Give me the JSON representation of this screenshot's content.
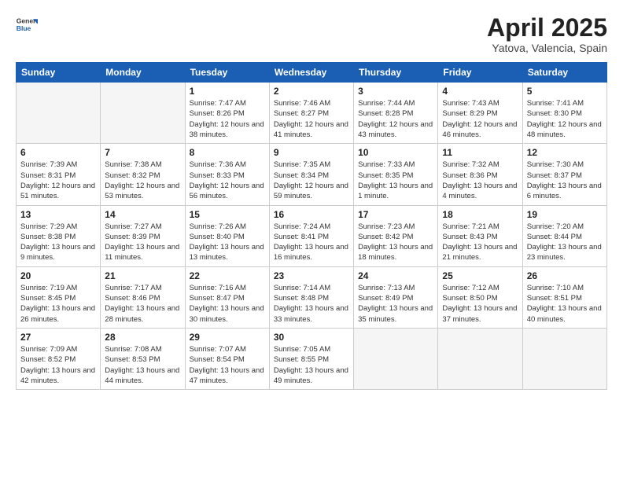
{
  "header": {
    "logo_general": "General",
    "logo_blue": "Blue",
    "title": "April 2025",
    "location": "Yatova, Valencia, Spain"
  },
  "weekdays": [
    "Sunday",
    "Monday",
    "Tuesday",
    "Wednesday",
    "Thursday",
    "Friday",
    "Saturday"
  ],
  "weeks": [
    [
      {
        "day": "",
        "info": ""
      },
      {
        "day": "",
        "info": ""
      },
      {
        "day": "1",
        "info": "Sunrise: 7:47 AM\nSunset: 8:26 PM\nDaylight: 12 hours and 38 minutes."
      },
      {
        "day": "2",
        "info": "Sunrise: 7:46 AM\nSunset: 8:27 PM\nDaylight: 12 hours and 41 minutes."
      },
      {
        "day": "3",
        "info": "Sunrise: 7:44 AM\nSunset: 8:28 PM\nDaylight: 12 hours and 43 minutes."
      },
      {
        "day": "4",
        "info": "Sunrise: 7:43 AM\nSunset: 8:29 PM\nDaylight: 12 hours and 46 minutes."
      },
      {
        "day": "5",
        "info": "Sunrise: 7:41 AM\nSunset: 8:30 PM\nDaylight: 12 hours and 48 minutes."
      }
    ],
    [
      {
        "day": "6",
        "info": "Sunrise: 7:39 AM\nSunset: 8:31 PM\nDaylight: 12 hours and 51 minutes."
      },
      {
        "day": "7",
        "info": "Sunrise: 7:38 AM\nSunset: 8:32 PM\nDaylight: 12 hours and 53 minutes."
      },
      {
        "day": "8",
        "info": "Sunrise: 7:36 AM\nSunset: 8:33 PM\nDaylight: 12 hours and 56 minutes."
      },
      {
        "day": "9",
        "info": "Sunrise: 7:35 AM\nSunset: 8:34 PM\nDaylight: 12 hours and 59 minutes."
      },
      {
        "day": "10",
        "info": "Sunrise: 7:33 AM\nSunset: 8:35 PM\nDaylight: 13 hours and 1 minute."
      },
      {
        "day": "11",
        "info": "Sunrise: 7:32 AM\nSunset: 8:36 PM\nDaylight: 13 hours and 4 minutes."
      },
      {
        "day": "12",
        "info": "Sunrise: 7:30 AM\nSunset: 8:37 PM\nDaylight: 13 hours and 6 minutes."
      }
    ],
    [
      {
        "day": "13",
        "info": "Sunrise: 7:29 AM\nSunset: 8:38 PM\nDaylight: 13 hours and 9 minutes."
      },
      {
        "day": "14",
        "info": "Sunrise: 7:27 AM\nSunset: 8:39 PM\nDaylight: 13 hours and 11 minutes."
      },
      {
        "day": "15",
        "info": "Sunrise: 7:26 AM\nSunset: 8:40 PM\nDaylight: 13 hours and 13 minutes."
      },
      {
        "day": "16",
        "info": "Sunrise: 7:24 AM\nSunset: 8:41 PM\nDaylight: 13 hours and 16 minutes."
      },
      {
        "day": "17",
        "info": "Sunrise: 7:23 AM\nSunset: 8:42 PM\nDaylight: 13 hours and 18 minutes."
      },
      {
        "day": "18",
        "info": "Sunrise: 7:21 AM\nSunset: 8:43 PM\nDaylight: 13 hours and 21 minutes."
      },
      {
        "day": "19",
        "info": "Sunrise: 7:20 AM\nSunset: 8:44 PM\nDaylight: 13 hours and 23 minutes."
      }
    ],
    [
      {
        "day": "20",
        "info": "Sunrise: 7:19 AM\nSunset: 8:45 PM\nDaylight: 13 hours and 26 minutes."
      },
      {
        "day": "21",
        "info": "Sunrise: 7:17 AM\nSunset: 8:46 PM\nDaylight: 13 hours and 28 minutes."
      },
      {
        "day": "22",
        "info": "Sunrise: 7:16 AM\nSunset: 8:47 PM\nDaylight: 13 hours and 30 minutes."
      },
      {
        "day": "23",
        "info": "Sunrise: 7:14 AM\nSunset: 8:48 PM\nDaylight: 13 hours and 33 minutes."
      },
      {
        "day": "24",
        "info": "Sunrise: 7:13 AM\nSunset: 8:49 PM\nDaylight: 13 hours and 35 minutes."
      },
      {
        "day": "25",
        "info": "Sunrise: 7:12 AM\nSunset: 8:50 PM\nDaylight: 13 hours and 37 minutes."
      },
      {
        "day": "26",
        "info": "Sunrise: 7:10 AM\nSunset: 8:51 PM\nDaylight: 13 hours and 40 minutes."
      }
    ],
    [
      {
        "day": "27",
        "info": "Sunrise: 7:09 AM\nSunset: 8:52 PM\nDaylight: 13 hours and 42 minutes."
      },
      {
        "day": "28",
        "info": "Sunrise: 7:08 AM\nSunset: 8:53 PM\nDaylight: 13 hours and 44 minutes."
      },
      {
        "day": "29",
        "info": "Sunrise: 7:07 AM\nSunset: 8:54 PM\nDaylight: 13 hours and 47 minutes."
      },
      {
        "day": "30",
        "info": "Sunrise: 7:05 AM\nSunset: 8:55 PM\nDaylight: 13 hours and 49 minutes."
      },
      {
        "day": "",
        "info": ""
      },
      {
        "day": "",
        "info": ""
      },
      {
        "day": "",
        "info": ""
      }
    ]
  ]
}
